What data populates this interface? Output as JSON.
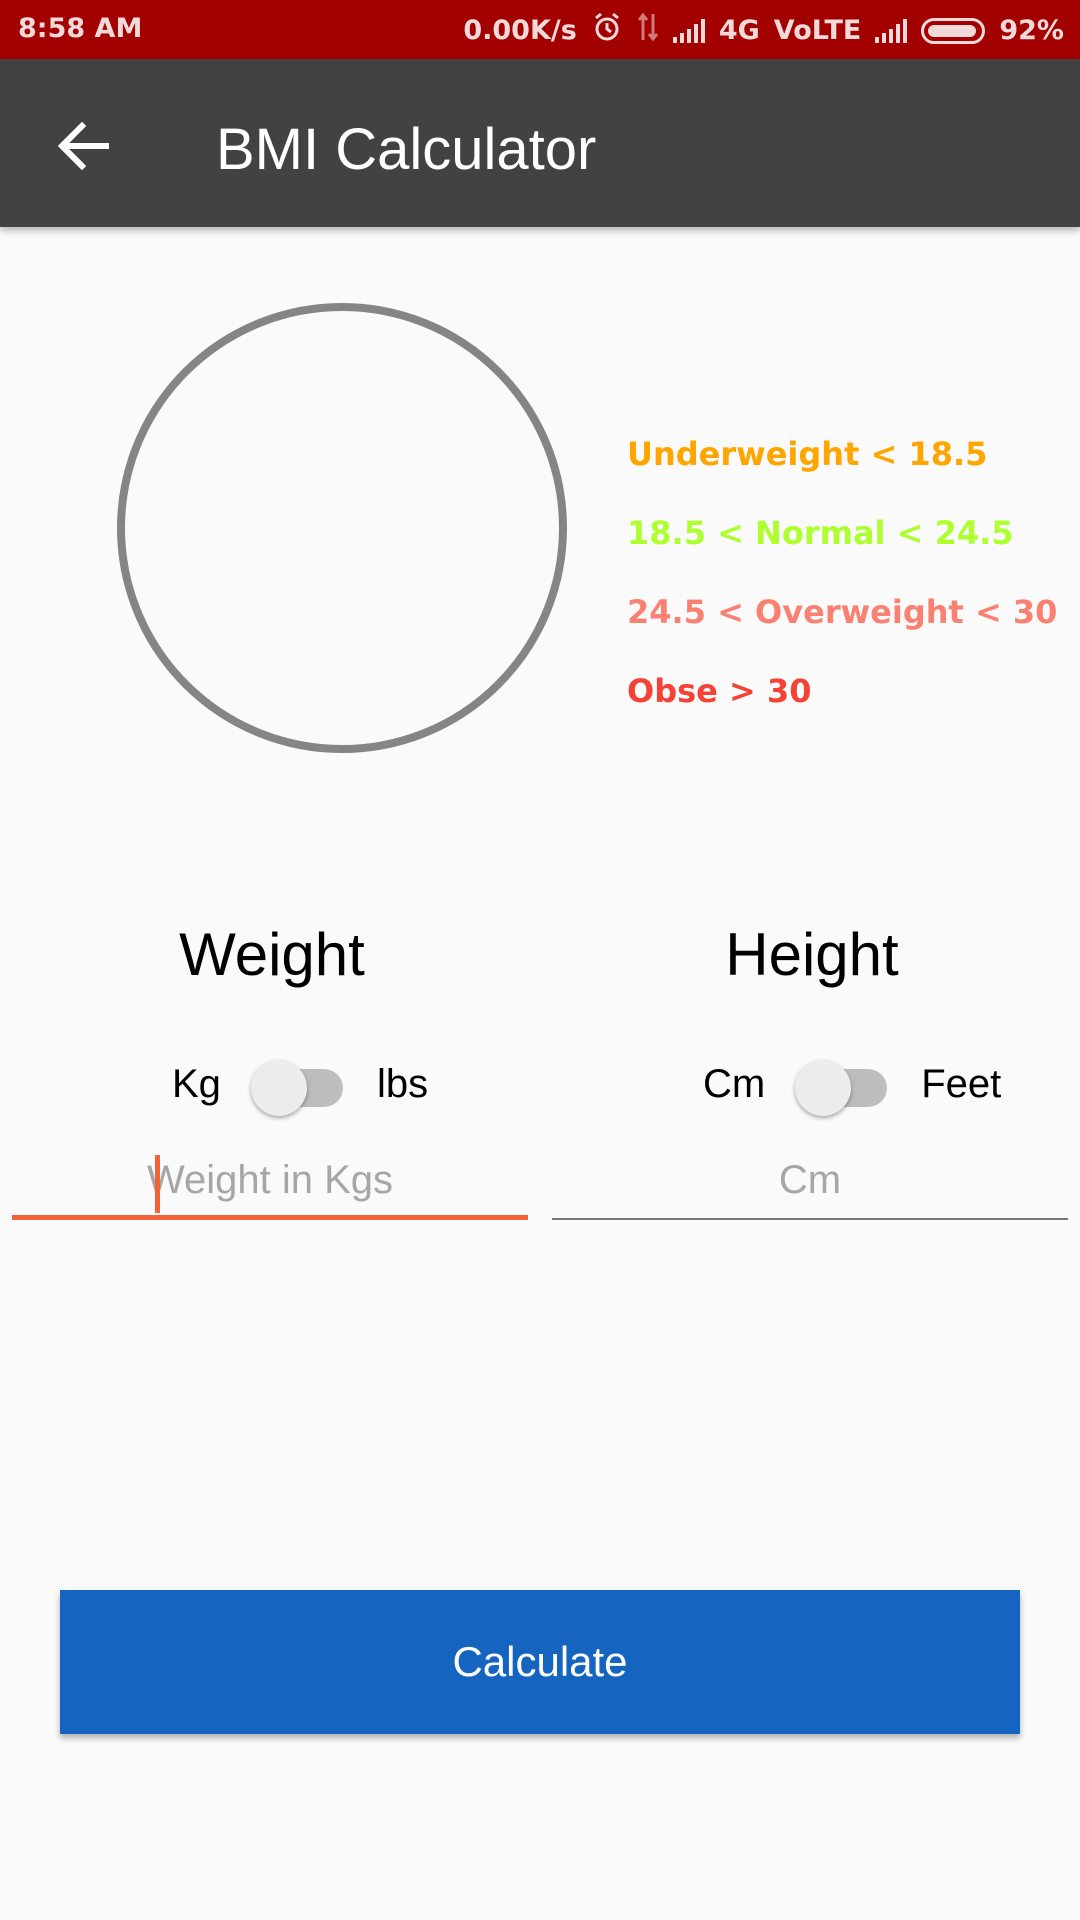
{
  "status_bar": {
    "time": "8:58 AM",
    "speed": "0.00K/s",
    "network": "4G",
    "volte": "VoLTE",
    "battery": "92%"
  },
  "app_bar": {
    "title": "BMI Calculator"
  },
  "legend": [
    {
      "label": "Underweight < 18.5",
      "color": "#ffa500"
    },
    {
      "label": "18.5 < Normal < 24.5",
      "color": "#adff2f"
    },
    {
      "label": "24.5 < Overweight < 30",
      "color": "#fa8072"
    },
    {
      "label": "Obse > 30",
      "color": "#f44336"
    }
  ],
  "weight": {
    "title": "Weight",
    "unit_left": "Kg",
    "unit_right": "lbs",
    "placeholder": "Weight in Kgs"
  },
  "height": {
    "title": "Height",
    "unit_left": "Cm",
    "unit_right": "Feet",
    "placeholder": "Cm"
  },
  "actions": {
    "calculate_label": "Calculate"
  }
}
